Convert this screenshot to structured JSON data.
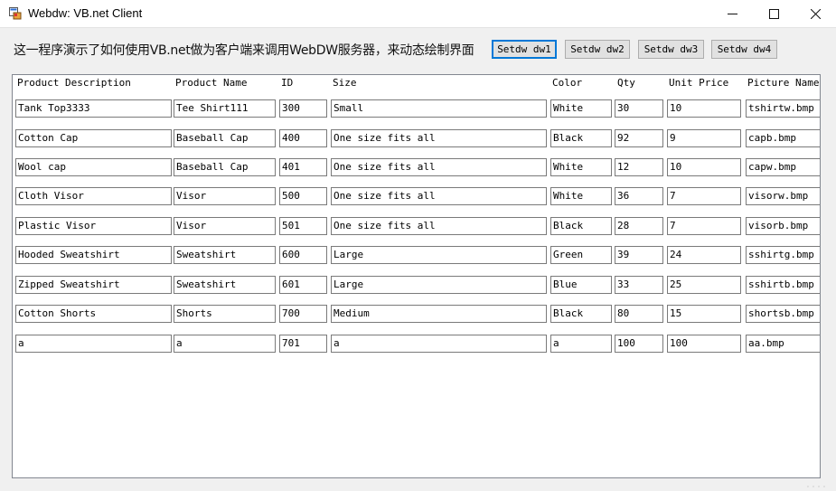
{
  "window": {
    "title": "Webdw: VB.net Client",
    "controls": [
      "minimize-icon",
      "maximize-icon",
      "close-icon"
    ]
  },
  "description": "这一程序演示了如何使用VB.net做为客户端来调用WebDW服务器，来动态绘制界面",
  "buttons": [
    {
      "label": "Setdw dw1",
      "active": true
    },
    {
      "label": "Setdw dw2",
      "active": false
    },
    {
      "label": "Setdw dw3",
      "active": false
    },
    {
      "label": "Setdw dw4",
      "active": false
    }
  ],
  "grid": {
    "headers": [
      "Product Description",
      "Product Name",
      "ID",
      "Size",
      "Color",
      "Qty",
      "Unit Price",
      "Picture Name"
    ],
    "rows": [
      [
        "Tank Top3333",
        "Tee Shirt111",
        "300",
        "Small",
        "White",
        "30",
        "10",
        "tshirtw.bmp"
      ],
      [
        "Cotton Cap",
        "Baseball Cap",
        "400",
        "One size fits all",
        "Black",
        "92",
        "9",
        "capb.bmp"
      ],
      [
        "Wool cap",
        "Baseball Cap",
        "401",
        "One size fits all",
        "White",
        "12",
        "10",
        "capw.bmp"
      ],
      [
        "Cloth Visor",
        "Visor",
        "500",
        "One size fits all",
        "White",
        "36",
        "7",
        "visorw.bmp"
      ],
      [
        "Plastic Visor",
        "Visor",
        "501",
        "One size fits all",
        "Black",
        "28",
        "7",
        "visorb.bmp"
      ],
      [
        "Hooded Sweatshirt",
        "Sweatshirt",
        "600",
        "Large",
        "Green",
        "39",
        "24",
        "sshirtg.bmp"
      ],
      [
        "Zipped Sweatshirt",
        "Sweatshirt",
        "601",
        "Large",
        "Blue",
        "33",
        "25",
        "sshirtb.bmp"
      ],
      [
        "Cotton Shorts",
        "Shorts",
        "700",
        "Medium",
        "Black",
        "80",
        "15",
        "shortsb.bmp"
      ],
      [
        "a",
        "a",
        "701",
        "a",
        "a",
        "100",
        "100",
        "aa.bmp"
      ]
    ]
  }
}
